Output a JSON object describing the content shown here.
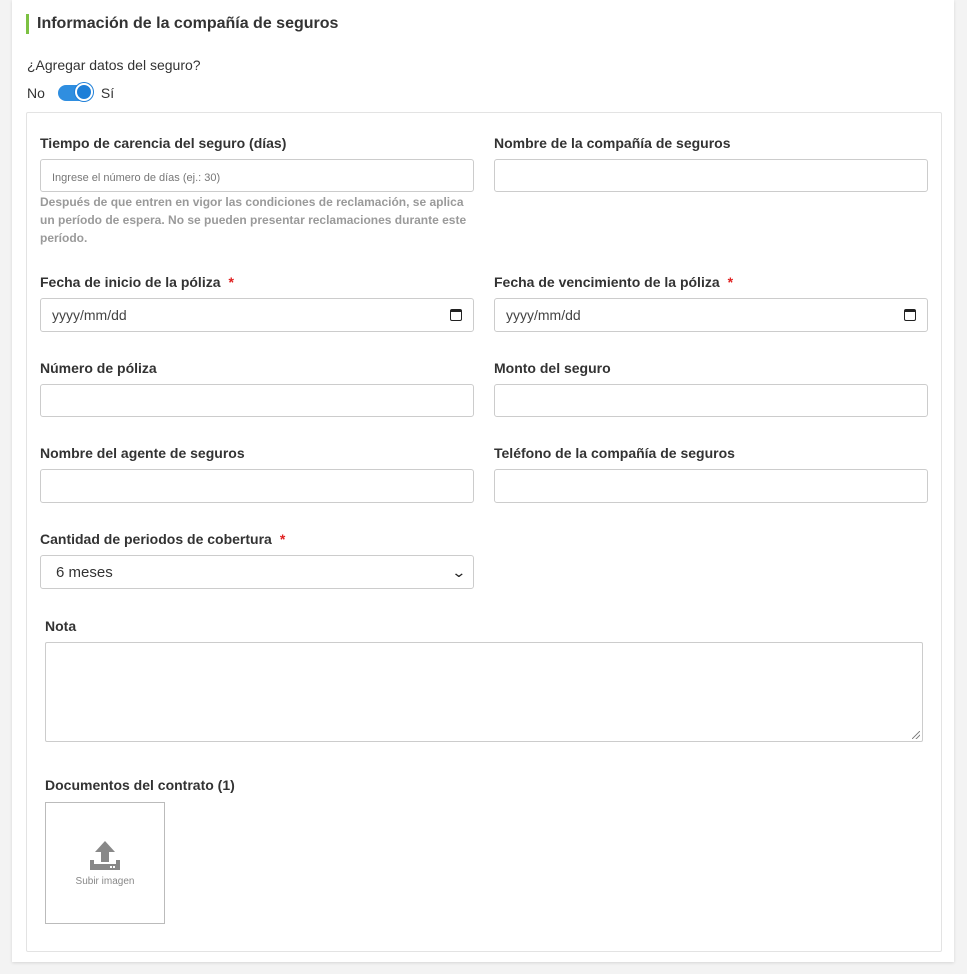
{
  "section": {
    "title": "Información de la compañía de seguros"
  },
  "add_insurance": {
    "question": "¿Agregar datos del seguro?",
    "no_label": "No",
    "yes_label": "Sí",
    "enabled": true
  },
  "fields": {
    "waiting_period": {
      "label": "Tiempo de carencia del seguro (días)",
      "placeholder": "Ingrese el número de días (ej.: 30)",
      "hint": "Después de que entren en vigor las condiciones de reclamación, se aplica un período de espera. No se pueden presentar reclamaciones durante este período.",
      "value": ""
    },
    "company_name": {
      "label": "Nombre de la compañía de seguros",
      "value": ""
    },
    "start_date": {
      "label": "Fecha de inicio de la póliza",
      "required": "*",
      "placeholder": "yyyy/mm/dd"
    },
    "end_date": {
      "label": "Fecha de vencimiento de la póliza",
      "required": "*",
      "placeholder": "yyyy/mm/dd"
    },
    "policy_number": {
      "label": "Número de póliza",
      "value": ""
    },
    "amount": {
      "label": "Monto del seguro",
      "value": ""
    },
    "agent_name": {
      "label": "Nombre del agente de seguros",
      "value": ""
    },
    "company_phone": {
      "label": "Teléfono de la compañía de seguros",
      "value": ""
    },
    "coverage_periods": {
      "label": "Cantidad de periodos de cobertura",
      "required": "*",
      "selected": "6 meses"
    },
    "note": {
      "label": "Nota",
      "value": ""
    },
    "documents": {
      "label": "Documentos del contrato (1)",
      "upload_label": "Subir imagen"
    }
  },
  "colors": {
    "accent_bar": "#7cc142",
    "toggle": "#2f8ee0",
    "required": "#e02020"
  },
  "icons": {
    "date": "calendar-icon",
    "select": "chevron-down-icon",
    "upload": "upload-icon"
  }
}
